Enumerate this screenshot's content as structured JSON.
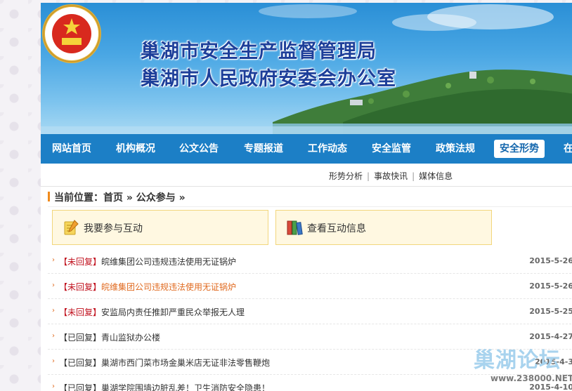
{
  "banner": {
    "title_line1": "巢湖市安全生产监督管理局",
    "title_line2": "巢湖市人民政府安委会办公室"
  },
  "nav": {
    "items": [
      {
        "label": "网站首页"
      },
      {
        "label": "机构概况"
      },
      {
        "label": "公文公告"
      },
      {
        "label": "专题报道"
      },
      {
        "label": "工作动态"
      },
      {
        "label": "安全监管"
      },
      {
        "label": "政策法规"
      },
      {
        "label": "安全形势",
        "active": true
      },
      {
        "label": "在"
      }
    ]
  },
  "subnav": {
    "links": [
      "形势分析",
      "事故快讯",
      "媒体信息"
    ],
    "separator": "|"
  },
  "breadcrumb": {
    "text": "当前位置：首页 » 公众参与 »"
  },
  "actions": {
    "participate": "我要参与互动",
    "view": "查看互动信息"
  },
  "list": [
    {
      "status": "【未回复】",
      "title": "皖维集团公司违规违法使用无证锅炉",
      "date": "2015-5-26",
      "status_color": "red",
      "highlight": false
    },
    {
      "status": "【未回复】",
      "title": "皖维集团公司违规违法使用无证锅炉",
      "date": "2015-5-26",
      "status_color": "red",
      "highlight": true
    },
    {
      "status": "【未回复】",
      "title": "安监局内责任推卸严重民众举报无人理",
      "date": "2015-5-25",
      "status_color": "red",
      "highlight": false
    },
    {
      "status": "【已回复】",
      "title": "青山监狱办公楼",
      "date": "2015-4-27",
      "status_color": "dark",
      "highlight": false
    },
    {
      "status": "【已回复】",
      "title": "巢湖市西门菜市场金巢米店无证非法零售鞭炮",
      "date": "2015-4-3",
      "status_color": "dark",
      "highlight": false
    },
    {
      "status": "【已回复】",
      "title": "巢湖学院围墙边脏乱差！卫生消防安全隐患！",
      "date": "2015-4-10",
      "status_color": "dark",
      "highlight": false
    }
  ],
  "watermark": {
    "name": "巢湖论坛",
    "url": "www.238000.NET"
  },
  "colors": {
    "nav_bg": "#1c7fc6",
    "title_blue": "#1d3f9a",
    "status_red": "#c1121f",
    "accent_orange": "#e06a1f",
    "button_bg": "#fff8e1"
  }
}
